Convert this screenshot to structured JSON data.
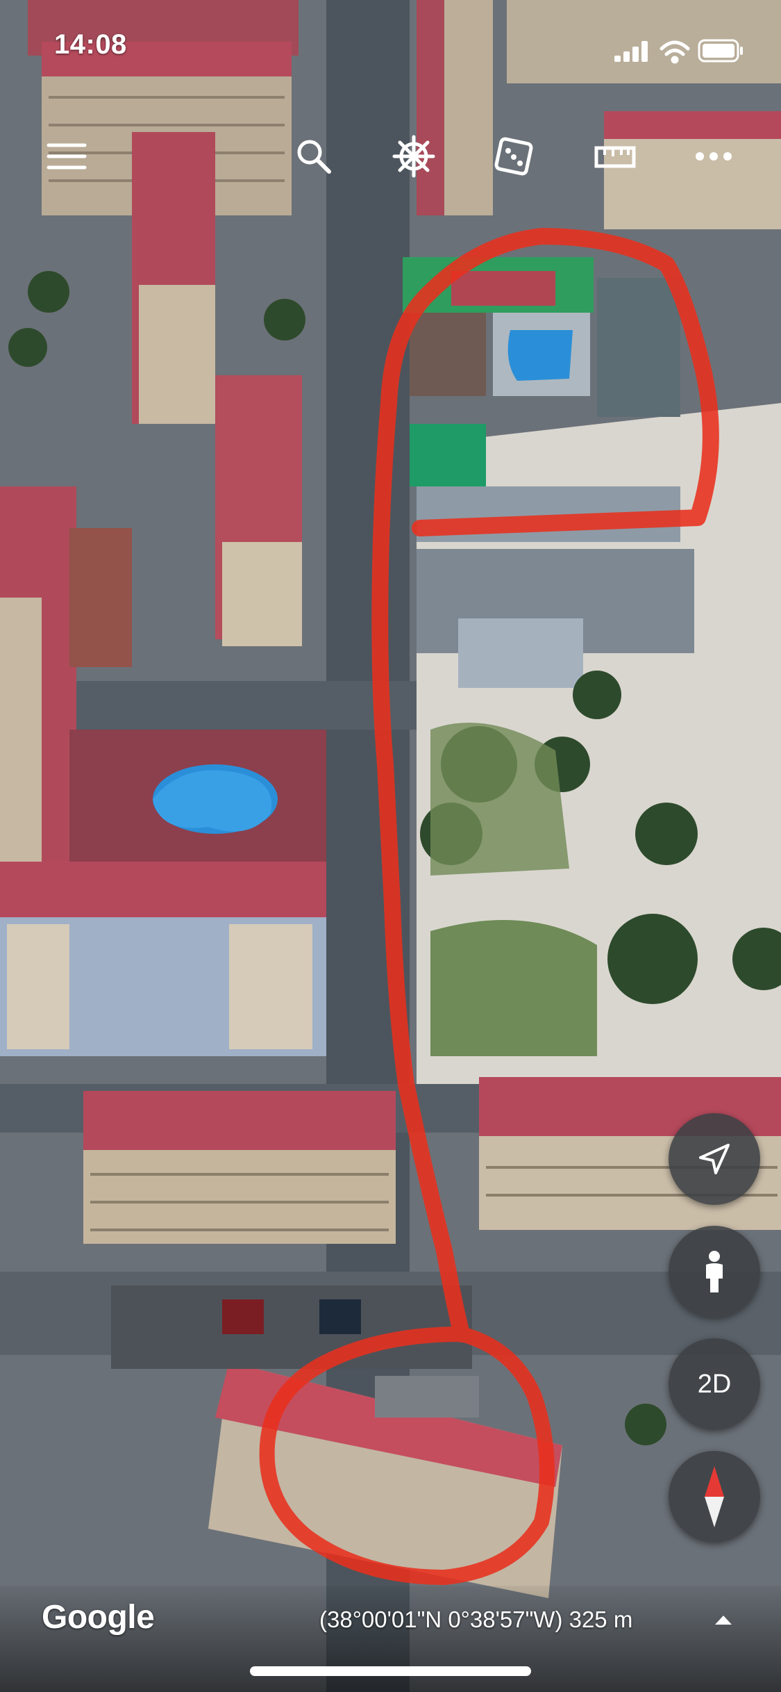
{
  "status_bar": {
    "time": "14:08"
  },
  "toolbar": {
    "items": [
      {
        "icon": "menu-icon"
      },
      {
        "icon": "search-icon"
      },
      {
        "icon": "voyager-wheel-icon"
      },
      {
        "icon": "dice-icon"
      },
      {
        "icon": "ruler-icon"
      },
      {
        "icon": "more-icon"
      }
    ]
  },
  "map_controls": {
    "locate_icon": "navigation-arrow-icon",
    "street_view_icon": "pegman-icon",
    "view_mode_label": "2D",
    "compass_icon": "compass-icon"
  },
  "footer": {
    "brand": "Google",
    "coordinates": "(38°00'01\"N 0°38'57\"W) 325 m"
  },
  "colors": {
    "route": "#e8301e",
    "fab_bg": "#3c4043",
    "roof": "#b8495a",
    "pool": "#2a8fd8"
  }
}
